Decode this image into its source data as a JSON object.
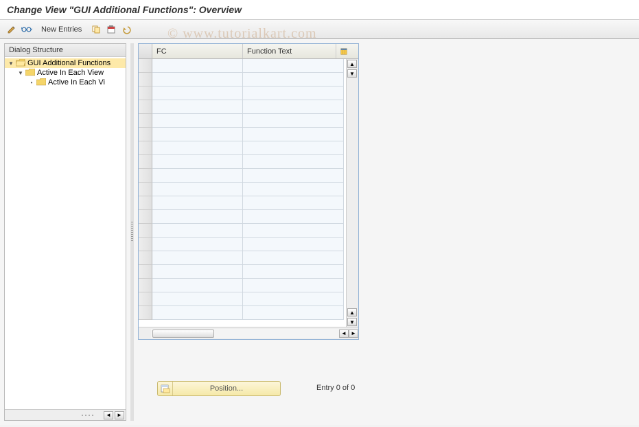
{
  "title": "Change View \"GUI Additional Functions\": Overview",
  "watermark": "© www.tutorialkart.com",
  "toolbar": {
    "new_entries_label": "New Entries",
    "icons": {
      "edit": "edit-icon",
      "glasses": "display-icon",
      "copy": "copy-icon",
      "delete": "delete-icon",
      "undo": "undo-icon"
    }
  },
  "dialog_structure": {
    "header": "Dialog Structure",
    "nodes": [
      {
        "label": "GUI Additional Functions",
        "level": 0,
        "open": true,
        "selected": true
      },
      {
        "label": "Active In Each View",
        "level": 1,
        "open": true,
        "selected": false
      },
      {
        "label": "Active In Each Vi",
        "level": 2,
        "open": false,
        "selected": false
      }
    ]
  },
  "grid": {
    "columns": {
      "fc": "FC",
      "function_text": "Function Text"
    },
    "row_count": 19
  },
  "position_button": {
    "label": "Position..."
  },
  "entry_status": "Entry 0 of 0"
}
